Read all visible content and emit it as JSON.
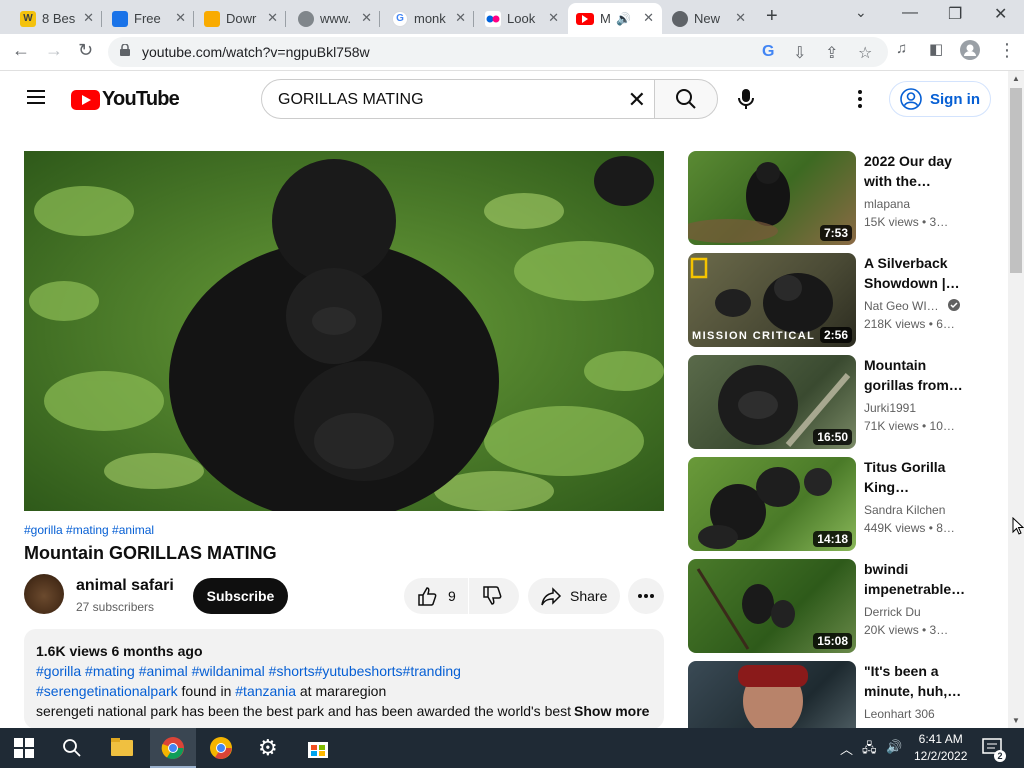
{
  "browser": {
    "tabs": [
      {
        "title": "8 Bes",
        "fav_color": "#f4c20d",
        "fav_text": "W"
      },
      {
        "title": "Free",
        "fav_color": "#1a73e8",
        "fav_text": ""
      },
      {
        "title": "Dowr",
        "fav_color": "#f9ab00",
        "fav_text": ""
      },
      {
        "title": "www.",
        "fav_color": "#5f6368",
        "fav_text": ""
      },
      {
        "title": "monk",
        "fav_color": "#4285f4",
        "fav_text": "G"
      },
      {
        "title": "Look",
        "fav_color": "#ff0084",
        "fav_text": ""
      },
      {
        "title": "M",
        "fav_color": "#ff0000",
        "fav_text": ""
      },
      {
        "title": "New",
        "fav_color": "#5f6368",
        "fav_text": ""
      }
    ],
    "url": "youtube.com/watch?v=ngpuBkl758w"
  },
  "youtube": {
    "logo_text": "YouTube",
    "search_query": "GORILLAS MATING",
    "signin_label": "Sign in"
  },
  "video": {
    "tags": "#gorilla #mating #animal",
    "title": "Mountain GORILLAS MATING",
    "channel_name": "animal safari",
    "subscribers": "27 subscribers",
    "subscribe_label": "Subscribe",
    "likes": "9",
    "share_label": "Share",
    "description": {
      "meta": "1.6K views  6 months ago",
      "line1": "#gorilla #mating #animal #wildanimal #shorts#yutubeshorts#tranding",
      "line2_link": "#serengetinationalpark",
      "line2_mid": " found in ",
      "line2_link2": "#tanzania",
      "line2_end": " at mararegion",
      "line3": "serengeti national park has been the best park and has been awarded the world's best",
      "show_more": "Show more"
    }
  },
  "recommendations": [
    {
      "title": "2022 Our day with the…",
      "channel": "mlapana",
      "views": "15K views  • 3…",
      "duration": "7:53",
      "verified": false
    },
    {
      "title": "A Silverback Showdown |…",
      "channel": "Nat Geo WI…",
      "views": "218K views  • 6…",
      "duration": "2:56",
      "verified": true,
      "overlay": "MISSION CRITICAL"
    },
    {
      "title": "Mountain gorillas from…",
      "channel": "Jurki1991",
      "views": "71K views  • 10…",
      "duration": "16:50",
      "verified": false
    },
    {
      "title": "Titus Gorilla King…",
      "channel": "Sandra Kilchen",
      "views": "449K views  • 8…",
      "duration": "14:18",
      "verified": false
    },
    {
      "title": "bwindi impenetrable…",
      "channel": "Derrick Du",
      "views": "20K views  • 3…",
      "duration": "15:08",
      "verified": false
    },
    {
      "title": "\"It's been a minute, huh,…",
      "channel": "Leonhart 306",
      "views": "",
      "duration": "",
      "verified": false
    }
  ],
  "taskbar": {
    "time": "6:41 AM",
    "date": "12/2/2022",
    "notif_count": "2"
  }
}
